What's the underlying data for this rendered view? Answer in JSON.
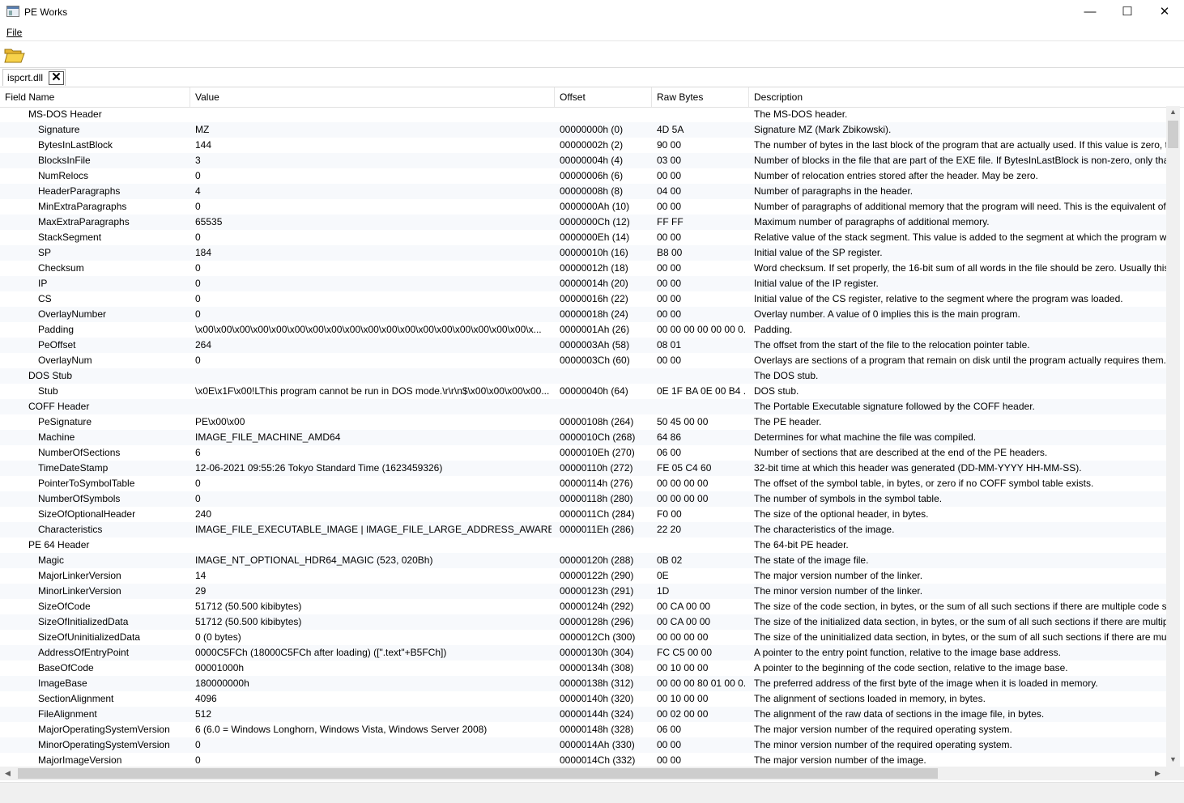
{
  "window": {
    "title": "PE Works",
    "minimize": "—",
    "maximize": "☐",
    "close": "✕"
  },
  "menu": {
    "file": "File"
  },
  "tab": {
    "label": "ispcrt.dll",
    "close_glyph": "✕"
  },
  "columns": [
    "Field Name",
    "Value",
    "Offset",
    "Raw Bytes",
    "Description"
  ],
  "rows": [
    {
      "type": "section",
      "name": "MS-DOS Header",
      "value": "",
      "offset": "",
      "raw": "",
      "desc": "The MS-DOS header."
    },
    {
      "type": "field",
      "name": "Signature",
      "value": "MZ",
      "offset": "00000000h (0)",
      "raw": "4D 5A",
      "desc": "Signature MZ (Mark Zbikowski)."
    },
    {
      "type": "field",
      "name": "BytesInLastBlock",
      "value": "144",
      "offset": "00000002h (2)",
      "raw": "90 00",
      "desc": "The number of bytes in the last block of the program that are actually used. If this value is zero, th"
    },
    {
      "type": "field",
      "name": "BlocksInFile",
      "value": "3",
      "offset": "00000004h (4)",
      "raw": "03 00",
      "desc": "Number of blocks in the file that are part of the EXE file. If BytesInLastBlock is non-zero, only that"
    },
    {
      "type": "field",
      "name": "NumRelocs",
      "value": "0",
      "offset": "00000006h (6)",
      "raw": "00 00",
      "desc": "Number of relocation entries stored after the header. May be zero."
    },
    {
      "type": "field",
      "name": "HeaderParagraphs",
      "value": "4",
      "offset": "00000008h (8)",
      "raw": "04 00",
      "desc": "Number of paragraphs in the header."
    },
    {
      "type": "field",
      "name": "MinExtraParagraphs",
      "value": "0",
      "offset": "0000000Ah (10)",
      "raw": "00 00",
      "desc": "Number of paragraphs of additional memory that the program will need. This is the equivalent of"
    },
    {
      "type": "field",
      "name": "MaxExtraParagraphs",
      "value": "65535",
      "offset": "0000000Ch (12)",
      "raw": "FF FF",
      "desc": "Maximum number of paragraphs of additional memory."
    },
    {
      "type": "field",
      "name": "StackSegment",
      "value": "0",
      "offset": "0000000Eh (14)",
      "raw": "00 00",
      "desc": "Relative value of the stack segment. This value is added to the segment at which the program wa"
    },
    {
      "type": "field",
      "name": "SP",
      "value": "184",
      "offset": "00000010h (16)",
      "raw": "B8 00",
      "desc": "Initial value of the SP register."
    },
    {
      "type": "field",
      "name": "Checksum",
      "value": "0",
      "offset": "00000012h (18)",
      "raw": "00 00",
      "desc": "Word checksum. If set properly, the 16-bit sum of all words in the file should be zero. Usually this"
    },
    {
      "type": "field",
      "name": "IP",
      "value": "0",
      "offset": "00000014h (20)",
      "raw": "00 00",
      "desc": "Initial value of the IP register."
    },
    {
      "type": "field",
      "name": "CS",
      "value": "0",
      "offset": "00000016h (22)",
      "raw": "00 00",
      "desc": "Initial value of the CS register, relative to the segment where the program was loaded."
    },
    {
      "type": "field",
      "name": "OverlayNumber",
      "value": "0",
      "offset": "00000018h (24)",
      "raw": "00 00",
      "desc": "Overlay number. A value of 0 implies this is the main program."
    },
    {
      "type": "field",
      "name": "Padding",
      "value": "\\x00\\x00\\x00\\x00\\x00\\x00\\x00\\x00\\x00\\x00\\x00\\x00\\x00\\x00\\x00\\x00\\x00\\x00\\x...",
      "offset": "0000001Ah (26)",
      "raw": "00 00 00 00 00 00 0...",
      "desc": "Padding."
    },
    {
      "type": "field",
      "name": "PeOffset",
      "value": "264",
      "offset": "0000003Ah (58)",
      "raw": "08 01",
      "desc": "The offset from the start of the file to the relocation pointer table."
    },
    {
      "type": "field",
      "name": "OverlayNum",
      "value": "0",
      "offset": "0000003Ch (60)",
      "raw": "00 00",
      "desc": "Overlays are sections of a program that remain on disk until the program actually requires them."
    },
    {
      "type": "section",
      "name": "DOS Stub",
      "value": "",
      "offset": "",
      "raw": "",
      "desc": "The DOS stub."
    },
    {
      "type": "field",
      "name": "Stub",
      "value": "\\x0E\\x1F\\x00!LThis program cannot be run in DOS mode.\\r\\r\\n$\\x00\\x00\\x00\\x00...",
      "offset": "00000040h (64)",
      "raw": "0E 1F BA 0E 00 B4 ...",
      "desc": "DOS stub."
    },
    {
      "type": "section",
      "name": "COFF Header",
      "value": "",
      "offset": "",
      "raw": "",
      "desc": "The Portable Executable signature followed by the COFF header."
    },
    {
      "type": "field",
      "name": "PeSignature",
      "value": "PE\\x00\\x00",
      "offset": "00000108h (264)",
      "raw": "50 45 00 00",
      "desc": "The PE header."
    },
    {
      "type": "field",
      "name": "Machine",
      "value": "IMAGE_FILE_MACHINE_AMD64",
      "offset": "0000010Ch (268)",
      "raw": "64 86",
      "desc": "Determines for what machine the file was compiled."
    },
    {
      "type": "field",
      "name": "NumberOfSections",
      "value": "6",
      "offset": "0000010Eh (270)",
      "raw": "06 00",
      "desc": "Number of sections that are described at the end of the PE headers."
    },
    {
      "type": "field",
      "name": "TimeDateStamp",
      "value": "12-06-2021 09:55:26 Tokyo Standard Time (1623459326)",
      "offset": "00000110h (272)",
      "raw": "FE 05 C4 60",
      "desc": "32-bit time at which this header was generated (DD-MM-YYYY HH-MM-SS)."
    },
    {
      "type": "field",
      "name": "PointerToSymbolTable",
      "value": "0",
      "offset": "00000114h (276)",
      "raw": "00 00 00 00",
      "desc": "The offset of the symbol table, in bytes, or zero if no COFF symbol table exists."
    },
    {
      "type": "field",
      "name": "NumberOfSymbols",
      "value": "0",
      "offset": "00000118h (280)",
      "raw": "00 00 00 00",
      "desc": "The number of symbols in the symbol table."
    },
    {
      "type": "field",
      "name": "SizeOfOptionalHeader",
      "value": "240",
      "offset": "0000011Ch (284)",
      "raw": "F0 00",
      "desc": "The size of the optional header, in bytes."
    },
    {
      "type": "field",
      "name": "Characteristics",
      "value": "IMAGE_FILE_EXECUTABLE_IMAGE | IMAGE_FILE_LARGE_ADDRESS_AWARE | IMAGE...",
      "offset": "0000011Eh (286)",
      "raw": "22 20",
      "desc": "The characteristics of the image."
    },
    {
      "type": "section",
      "name": "PE 64 Header",
      "value": "",
      "offset": "",
      "raw": "",
      "desc": "The 64-bit PE header."
    },
    {
      "type": "field",
      "name": "Magic",
      "value": "IMAGE_NT_OPTIONAL_HDR64_MAGIC (523, 020Bh)",
      "offset": "00000120h (288)",
      "raw": "0B 02",
      "desc": "The state of the image file."
    },
    {
      "type": "field",
      "name": "MajorLinkerVersion",
      "value": "14",
      "offset": "00000122h (290)",
      "raw": "0E",
      "desc": "The major version number of the linker."
    },
    {
      "type": "field",
      "name": "MinorLinkerVersion",
      "value": "29",
      "offset": "00000123h (291)",
      "raw": "1D",
      "desc": "The minor version number of the linker."
    },
    {
      "type": "field",
      "name": "SizeOfCode",
      "value": "51712 (50.500 kibibytes)",
      "offset": "00000124h (292)",
      "raw": "00 CA 00 00",
      "desc": "The size of the code section, in bytes, or the sum of all such sections if there are multiple code sec"
    },
    {
      "type": "field",
      "name": "SizeOfInitializedData",
      "value": "51712 (50.500 kibibytes)",
      "offset": "00000128h (296)",
      "raw": "00 CA 00 00",
      "desc": "The size of the initialized data section, in bytes, or the sum of all such sections if there are multipl"
    },
    {
      "type": "field",
      "name": "SizeOfUninitializedData",
      "value": "0 (0 bytes)",
      "offset": "0000012Ch (300)",
      "raw": "00 00 00 00",
      "desc": "The size of the uninitialized data section, in bytes, or the sum of all such sections if there are mult"
    },
    {
      "type": "field",
      "name": "AddressOfEntryPoint",
      "value": "0000C5FCh (18000C5FCh after loading) ([\".text\"+B5FCh])",
      "offset": "00000130h (304)",
      "raw": "FC C5 00 00",
      "desc": "A pointer to the entry point function, relative to the image base address."
    },
    {
      "type": "field",
      "name": "BaseOfCode",
      "value": "00001000h",
      "offset": "00000134h (308)",
      "raw": "00 10 00 00",
      "desc": "A pointer to the beginning of the code section, relative to the image base."
    },
    {
      "type": "field",
      "name": "ImageBase",
      "value": "180000000h",
      "offset": "00000138h (312)",
      "raw": "00 00 00 80 01 00 0...",
      "desc": "The preferred address of the first byte of the image when it is loaded in memory."
    },
    {
      "type": "field",
      "name": "SectionAlignment",
      "value": "4096",
      "offset": "00000140h (320)",
      "raw": "00 10 00 00",
      "desc": "The alignment of sections loaded in memory, in bytes."
    },
    {
      "type": "field",
      "name": "FileAlignment",
      "value": "512",
      "offset": "00000144h (324)",
      "raw": "00 02 00 00",
      "desc": "The alignment of the raw data of sections in the image file, in bytes."
    },
    {
      "type": "field",
      "name": "MajorOperatingSystemVersion",
      "value": "6 (6.0 = Windows Longhorn, Windows Vista, Windows Server 2008)",
      "offset": "00000148h (328)",
      "raw": "06 00",
      "desc": "The major version number of the required operating system."
    },
    {
      "type": "field",
      "name": "MinorOperatingSystemVersion",
      "value": "0",
      "offset": "0000014Ah (330)",
      "raw": "00 00",
      "desc": "The minor version number of the required operating system."
    },
    {
      "type": "field",
      "name": "MajorImageVersion",
      "value": "0",
      "offset": "0000014Ch (332)",
      "raw": "00 00",
      "desc": "The major version number of the image."
    }
  ],
  "scroll": {
    "up": "▲",
    "down": "▼",
    "left": "◀",
    "right": "▶"
  }
}
